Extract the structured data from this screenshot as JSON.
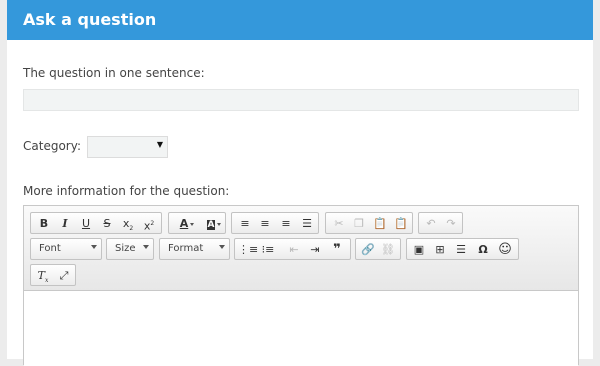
{
  "header": {
    "title": "Ask a question"
  },
  "question": {
    "label": "The question in one sentence:",
    "value": "",
    "placeholder": ""
  },
  "category": {
    "label": "Category:",
    "selected": ""
  },
  "info": {
    "label": "More information for the question:"
  },
  "editor": {
    "combos": {
      "font": "Font",
      "size": "Size",
      "format": "Format"
    },
    "symbols": {
      "bold": "B",
      "italic": "I",
      "underline": "U",
      "strike": "S",
      "quote": "❞",
      "omega": "Ω",
      "smiley": "☺",
      "text_color": "A",
      "bg_color": "A"
    }
  }
}
